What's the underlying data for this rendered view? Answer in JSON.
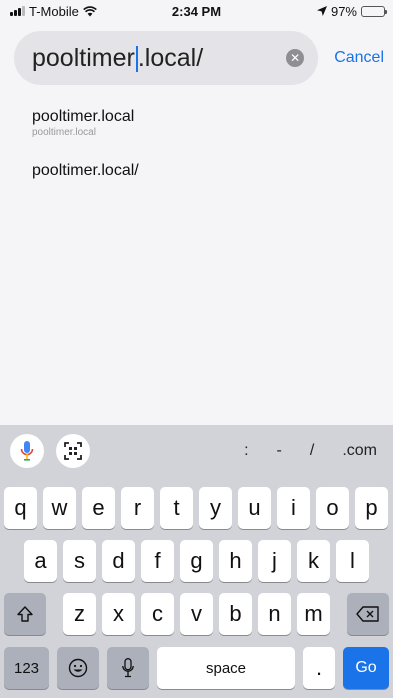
{
  "status_bar": {
    "carrier": "T-Mobile",
    "time": "2:34 PM",
    "battery": "97%",
    "battery_level": 0.97
  },
  "search": {
    "text_before_caret": "pooltimer",
    "text_after_caret": ".local/",
    "cancel_label": "Cancel",
    "clear_icon": "clear-icon"
  },
  "suggestions": [
    {
      "title": "pooltimer.local",
      "subtitle": "pooltimer.local"
    },
    {
      "title": "pooltimer.local/"
    }
  ],
  "keyboard": {
    "shortcuts": [
      ":",
      "-",
      "/",
      ".com"
    ],
    "row1": [
      "q",
      "w",
      "e",
      "r",
      "t",
      "y",
      "u",
      "i",
      "o",
      "p"
    ],
    "row2": [
      "a",
      "s",
      "d",
      "f",
      "g",
      "h",
      "j",
      "k",
      "l"
    ],
    "row3": [
      "z",
      "x",
      "c",
      "v",
      "b",
      "n",
      "m"
    ],
    "numbers_label": "123",
    "space_label": "space",
    "period_label": ".",
    "go_label": "Go",
    "accent_color": "#1a73e8"
  }
}
